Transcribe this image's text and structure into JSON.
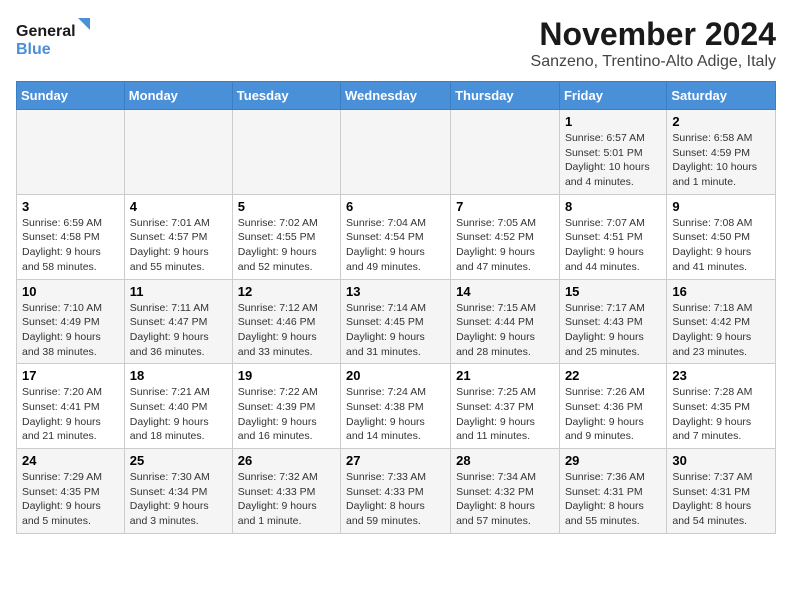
{
  "logo": {
    "line1": "General",
    "line2": "Blue"
  },
  "title": "November 2024",
  "location": "Sanzeno, Trentino-Alto Adige, Italy",
  "days_of_week": [
    "Sunday",
    "Monday",
    "Tuesday",
    "Wednesday",
    "Thursday",
    "Friday",
    "Saturday"
  ],
  "weeks": [
    [
      {
        "day": "",
        "sunrise": "",
        "sunset": "",
        "daylight": ""
      },
      {
        "day": "",
        "sunrise": "",
        "sunset": "",
        "daylight": ""
      },
      {
        "day": "",
        "sunrise": "",
        "sunset": "",
        "daylight": ""
      },
      {
        "day": "",
        "sunrise": "",
        "sunset": "",
        "daylight": ""
      },
      {
        "day": "",
        "sunrise": "",
        "sunset": "",
        "daylight": ""
      },
      {
        "day": "1",
        "sunrise": "Sunrise: 6:57 AM",
        "sunset": "Sunset: 5:01 PM",
        "daylight": "Daylight: 10 hours and 4 minutes."
      },
      {
        "day": "2",
        "sunrise": "Sunrise: 6:58 AM",
        "sunset": "Sunset: 4:59 PM",
        "daylight": "Daylight: 10 hours and 1 minute."
      }
    ],
    [
      {
        "day": "3",
        "sunrise": "Sunrise: 6:59 AM",
        "sunset": "Sunset: 4:58 PM",
        "daylight": "Daylight: 9 hours and 58 minutes."
      },
      {
        "day": "4",
        "sunrise": "Sunrise: 7:01 AM",
        "sunset": "Sunset: 4:57 PM",
        "daylight": "Daylight: 9 hours and 55 minutes."
      },
      {
        "day": "5",
        "sunrise": "Sunrise: 7:02 AM",
        "sunset": "Sunset: 4:55 PM",
        "daylight": "Daylight: 9 hours and 52 minutes."
      },
      {
        "day": "6",
        "sunrise": "Sunrise: 7:04 AM",
        "sunset": "Sunset: 4:54 PM",
        "daylight": "Daylight: 9 hours and 49 minutes."
      },
      {
        "day": "7",
        "sunrise": "Sunrise: 7:05 AM",
        "sunset": "Sunset: 4:52 PM",
        "daylight": "Daylight: 9 hours and 47 minutes."
      },
      {
        "day": "8",
        "sunrise": "Sunrise: 7:07 AM",
        "sunset": "Sunset: 4:51 PM",
        "daylight": "Daylight: 9 hours and 44 minutes."
      },
      {
        "day": "9",
        "sunrise": "Sunrise: 7:08 AM",
        "sunset": "Sunset: 4:50 PM",
        "daylight": "Daylight: 9 hours and 41 minutes."
      }
    ],
    [
      {
        "day": "10",
        "sunrise": "Sunrise: 7:10 AM",
        "sunset": "Sunset: 4:49 PM",
        "daylight": "Daylight: 9 hours and 38 minutes."
      },
      {
        "day": "11",
        "sunrise": "Sunrise: 7:11 AM",
        "sunset": "Sunset: 4:47 PM",
        "daylight": "Daylight: 9 hours and 36 minutes."
      },
      {
        "day": "12",
        "sunrise": "Sunrise: 7:12 AM",
        "sunset": "Sunset: 4:46 PM",
        "daylight": "Daylight: 9 hours and 33 minutes."
      },
      {
        "day": "13",
        "sunrise": "Sunrise: 7:14 AM",
        "sunset": "Sunset: 4:45 PM",
        "daylight": "Daylight: 9 hours and 31 minutes."
      },
      {
        "day": "14",
        "sunrise": "Sunrise: 7:15 AM",
        "sunset": "Sunset: 4:44 PM",
        "daylight": "Daylight: 9 hours and 28 minutes."
      },
      {
        "day": "15",
        "sunrise": "Sunrise: 7:17 AM",
        "sunset": "Sunset: 4:43 PM",
        "daylight": "Daylight: 9 hours and 25 minutes."
      },
      {
        "day": "16",
        "sunrise": "Sunrise: 7:18 AM",
        "sunset": "Sunset: 4:42 PM",
        "daylight": "Daylight: 9 hours and 23 minutes."
      }
    ],
    [
      {
        "day": "17",
        "sunrise": "Sunrise: 7:20 AM",
        "sunset": "Sunset: 4:41 PM",
        "daylight": "Daylight: 9 hours and 21 minutes."
      },
      {
        "day": "18",
        "sunrise": "Sunrise: 7:21 AM",
        "sunset": "Sunset: 4:40 PM",
        "daylight": "Daylight: 9 hours and 18 minutes."
      },
      {
        "day": "19",
        "sunrise": "Sunrise: 7:22 AM",
        "sunset": "Sunset: 4:39 PM",
        "daylight": "Daylight: 9 hours and 16 minutes."
      },
      {
        "day": "20",
        "sunrise": "Sunrise: 7:24 AM",
        "sunset": "Sunset: 4:38 PM",
        "daylight": "Daylight: 9 hours and 14 minutes."
      },
      {
        "day": "21",
        "sunrise": "Sunrise: 7:25 AM",
        "sunset": "Sunset: 4:37 PM",
        "daylight": "Daylight: 9 hours and 11 minutes."
      },
      {
        "day": "22",
        "sunrise": "Sunrise: 7:26 AM",
        "sunset": "Sunset: 4:36 PM",
        "daylight": "Daylight: 9 hours and 9 minutes."
      },
      {
        "day": "23",
        "sunrise": "Sunrise: 7:28 AM",
        "sunset": "Sunset: 4:35 PM",
        "daylight": "Daylight: 9 hours and 7 minutes."
      }
    ],
    [
      {
        "day": "24",
        "sunrise": "Sunrise: 7:29 AM",
        "sunset": "Sunset: 4:35 PM",
        "daylight": "Daylight: 9 hours and 5 minutes."
      },
      {
        "day": "25",
        "sunrise": "Sunrise: 7:30 AM",
        "sunset": "Sunset: 4:34 PM",
        "daylight": "Daylight: 9 hours and 3 minutes."
      },
      {
        "day": "26",
        "sunrise": "Sunrise: 7:32 AM",
        "sunset": "Sunset: 4:33 PM",
        "daylight": "Daylight: 9 hours and 1 minute."
      },
      {
        "day": "27",
        "sunrise": "Sunrise: 7:33 AM",
        "sunset": "Sunset: 4:33 PM",
        "daylight": "Daylight: 8 hours and 59 minutes."
      },
      {
        "day": "28",
        "sunrise": "Sunrise: 7:34 AM",
        "sunset": "Sunset: 4:32 PM",
        "daylight": "Daylight: 8 hours and 57 minutes."
      },
      {
        "day": "29",
        "sunrise": "Sunrise: 7:36 AM",
        "sunset": "Sunset: 4:31 PM",
        "daylight": "Daylight: 8 hours and 55 minutes."
      },
      {
        "day": "30",
        "sunrise": "Sunrise: 7:37 AM",
        "sunset": "Sunset: 4:31 PM",
        "daylight": "Daylight: 8 hours and 54 minutes."
      }
    ]
  ]
}
